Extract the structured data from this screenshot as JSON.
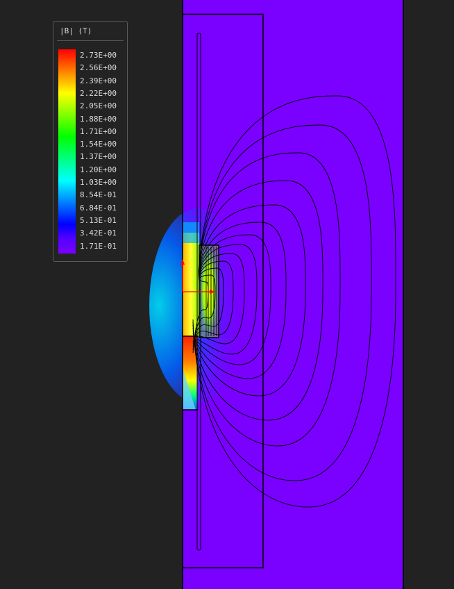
{
  "legend": {
    "title": "|B| (T)",
    "colors": [
      "#ff0000",
      "#ff5500",
      "#ffaa00",
      "#ffff00",
      "#aaff00",
      "#55ff00",
      "#00ff00",
      "#00ff55",
      "#00ffaa",
      "#00ffff",
      "#00aaff",
      "#0055ff",
      "#0000ff",
      "#5500ff",
      "#7a00ff"
    ],
    "values": [
      "2.73E+00",
      "2.56E+00",
      "2.39E+00",
      "2.22E+00",
      "2.05E+00",
      "1.88E+00",
      "1.71E+00",
      "1.54E+00",
      "1.37E+00",
      "1.20E+00",
      "1.03E+00",
      "8.54E-01",
      "6.84E-01",
      "5.13E-01",
      "3.42E-01",
      "1.71E-01"
    ]
  },
  "field_plot": {
    "background_color": "#7a00ff",
    "outline_color": "#000000",
    "axis_color": "#ff0000"
  }
}
